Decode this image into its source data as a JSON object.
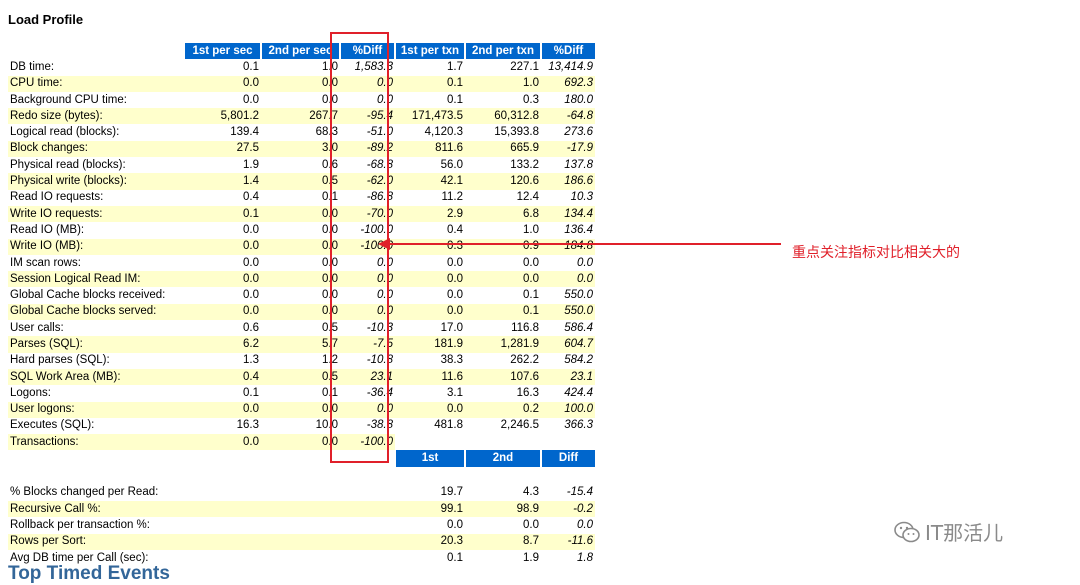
{
  "title": "Load Profile",
  "headers": [
    "1st per sec",
    "2nd per sec",
    "%Diff",
    "1st per txn",
    "2nd per txn",
    "%Diff"
  ],
  "rows": [
    {
      "label": "DB time:",
      "s1": "0.1",
      "s2": "1.0",
      "sd": "1,583.3",
      "t1": "1.7",
      "t2": "227.1",
      "td": "13,414.9"
    },
    {
      "label": "CPU time:",
      "s1": "0.0",
      "s2": "0.0",
      "sd": "0.0",
      "t1": "0.1",
      "t2": "1.0",
      "td": "692.3"
    },
    {
      "label": "Background CPU time:",
      "s1": "0.0",
      "s2": "0.0",
      "sd": "0.0",
      "t1": "0.1",
      "t2": "0.3",
      "td": "180.0"
    },
    {
      "label": "Redo size (bytes):",
      "s1": "5,801.2",
      "s2": "267.7",
      "sd": "-95.4",
      "t1": "171,473.5",
      "t2": "60,312.8",
      "td": "-64.8"
    },
    {
      "label": "Logical read (blocks):",
      "s1": "139.4",
      "s2": "68.3",
      "sd": "-51.0",
      "t1": "4,120.3",
      "t2": "15,393.8",
      "td": "273.6"
    },
    {
      "label": "Block changes:",
      "s1": "27.5",
      "s2": "3.0",
      "sd": "-89.2",
      "t1": "811.6",
      "t2": "665.9",
      "td": "-17.9"
    },
    {
      "label": "Physical read (blocks):",
      "s1": "1.9",
      "s2": "0.6",
      "sd": "-68.8",
      "t1": "56.0",
      "t2": "133.2",
      "td": "137.8"
    },
    {
      "label": "Physical write (blocks):",
      "s1": "1.4",
      "s2": "0.5",
      "sd": "-62.0",
      "t1": "42.1",
      "t2": "120.6",
      "td": "186.6"
    },
    {
      "label": "Read IO requests:",
      "s1": "0.4",
      "s2": "0.1",
      "sd": "-86.8",
      "t1": "11.2",
      "t2": "12.4",
      "td": "10.3"
    },
    {
      "label": "Write IO requests:",
      "s1": "0.1",
      "s2": "0.0",
      "sd": "-70.0",
      "t1": "2.9",
      "t2": "6.8",
      "td": "134.4"
    },
    {
      "label": "Read IO (MB):",
      "s1": "0.0",
      "s2": "0.0",
      "sd": "-100.0",
      "t1": "0.4",
      "t2": "1.0",
      "td": "136.4"
    },
    {
      "label": "Write IO (MB):",
      "s1": "0.0",
      "s2": "0.0",
      "sd": "-100.0",
      "t1": "0.3",
      "t2": "0.9",
      "td": "184.8"
    },
    {
      "label": "IM scan rows:",
      "s1": "0.0",
      "s2": "0.0",
      "sd": "0.0",
      "t1": "0.0",
      "t2": "0.0",
      "td": "0.0"
    },
    {
      "label": "Session Logical Read IM:",
      "s1": "0.0",
      "s2": "0.0",
      "sd": "0.0",
      "t1": "0.0",
      "t2": "0.0",
      "td": "0.0"
    },
    {
      "label": "Global Cache blocks received:",
      "s1": "0.0",
      "s2": "0.0",
      "sd": "0.0",
      "t1": "0.0",
      "t2": "0.1",
      "td": "550.0"
    },
    {
      "label": "Global Cache blocks served:",
      "s1": "0.0",
      "s2": "0.0",
      "sd": "0.0",
      "t1": "0.0",
      "t2": "0.1",
      "td": "550.0"
    },
    {
      "label": "User calls:",
      "s1": "0.6",
      "s2": "0.5",
      "sd": "-10.3",
      "t1": "17.0",
      "t2": "116.8",
      "td": "586.4"
    },
    {
      "label": "Parses (SQL):",
      "s1": "6.2",
      "s2": "5.7",
      "sd": "-7.5",
      "t1": "181.9",
      "t2": "1,281.9",
      "td": "604.7"
    },
    {
      "label": "Hard parses (SQL):",
      "s1": "1.3",
      "s2": "1.2",
      "sd": "-10.8",
      "t1": "38.3",
      "t2": "262.2",
      "td": "584.2"
    },
    {
      "label": "SQL Work Area (MB):",
      "s1": "0.4",
      "s2": "0.5",
      "sd": "23.1",
      "t1": "11.6",
      "t2": "107.6",
      "td": "23.1"
    },
    {
      "label": "Logons:",
      "s1": "0.1",
      "s2": "0.1",
      "sd": "-36.4",
      "t1": "3.1",
      "t2": "16.3",
      "td": "424.4"
    },
    {
      "label": "User logons:",
      "s1": "0.0",
      "s2": "0.0",
      "sd": "0.0",
      "t1": "0.0",
      "t2": "0.2",
      "td": "100.0"
    },
    {
      "label": "Executes (SQL):",
      "s1": "16.3",
      "s2": "10.0",
      "sd": "-38.8",
      "t1": "481.8",
      "t2": "2,246.5",
      "td": "366.3"
    },
    {
      "label": "Transactions:",
      "s1": "0.0",
      "s2": "0.0",
      "sd": "-100.0",
      "t1": "",
      "t2": "",
      "td": ""
    }
  ],
  "sub_headers": [
    "1st",
    "2nd",
    "Diff"
  ],
  "sub_rows": [
    {
      "label": "% Blocks changed per Read:",
      "v1": "19.7",
      "v2": "4.3",
      "d": "-15.4"
    },
    {
      "label": "Recursive Call %:",
      "v1": "99.1",
      "v2": "98.9",
      "d": "-0.2"
    },
    {
      "label": "Rollback per transaction %:",
      "v1": "0.0",
      "v2": "0.0",
      "d": "0.0"
    },
    {
      "label": "Rows per Sort:",
      "v1": "20.3",
      "v2": "8.7",
      "d": "-11.6"
    },
    {
      "label": "Avg DB time per Call (sec):",
      "v1": "0.1",
      "v2": "1.9",
      "d": "1.8"
    }
  ],
  "annotation": "重点关注指标对比相关大的",
  "watermark": "IT那活儿",
  "next_section": "Top Timed Events",
  "colors": {
    "header_bg": "#0066cc",
    "alt_row": "#ffffcc",
    "highlight": "#e0202a"
  }
}
